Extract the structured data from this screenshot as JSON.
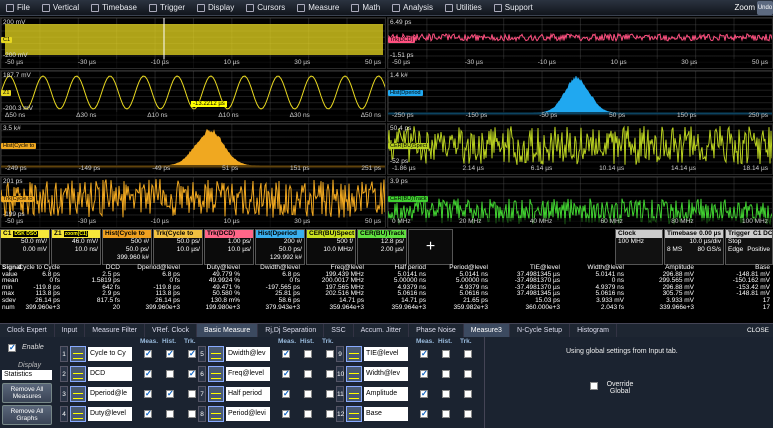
{
  "menu": [
    {
      "label": "File",
      "icon": "folder-icon"
    },
    {
      "label": "Vertical",
      "icon": "vertical-icon"
    },
    {
      "label": "Timebase",
      "icon": "timebase-icon"
    },
    {
      "label": "Trigger",
      "icon": "trigger-icon"
    },
    {
      "label": "Display",
      "icon": "display-icon"
    },
    {
      "label": "Cursors",
      "icon": "cursors-icon"
    },
    {
      "label": "Measure",
      "icon": "measure-icon"
    },
    {
      "label": "Math",
      "icon": "math-icon"
    },
    {
      "label": "Analysis",
      "icon": "analysis-icon"
    },
    {
      "label": "Utilities",
      "icon": "utilities-icon"
    },
    {
      "label": "Support",
      "icon": "support-icon"
    }
  ],
  "zoom": {
    "label": "Zoom",
    "btn": "Undo"
  },
  "panels": {
    "p1": {
      "ytop": "200 mV",
      "ybot": "-200 mV",
      "tag": "C1",
      "ticks": [
        "-50 µs",
        "-30 µs",
        "-10 µs",
        "10 µs",
        "30 µs",
        "50 µs"
      ]
    },
    "p2": {
      "ytop": "187.7 mV",
      "ybot": "-200.3 mV",
      "tag": "Z1",
      "cursor": "-13.2212 µs",
      "ticks": [
        "Δ50 ns",
        "Δ30 ns",
        "Δ10 ns",
        "Δ10 ns",
        "Δ30 ns",
        "Δ50 ns"
      ]
    },
    "p3": {
      "ytop": "3.5 k#",
      "tag": "Hist(Cycle to",
      "ticks": [
        "-249 ps",
        "-149 ps",
        "-49 ps",
        "51 ps",
        "151 ps",
        "251 ps"
      ]
    },
    "p4": {
      "ytop": "201 ps",
      "ybot": "-199 ps",
      "tag": "Trk(Cycle to",
      "ticks": [
        "-50 µs",
        "-30 µs",
        "-10 µs",
        "10 µs",
        "30 µs",
        "50 µs"
      ]
    },
    "p5": {
      "ytop": "6.49 ps",
      "ybot": "-1.51 ps",
      "tag": "Trk(DCD)",
      "ticks": [
        "-50 µs",
        "-30 µs",
        "-10 µs",
        "10 µs",
        "30 µs",
        "50 µs"
      ]
    },
    "p6": {
      "ytop": "1.4 k#",
      "tag": "Hist(Dperiod",
      "ticks": [
        "-250 ps",
        "-150 ps",
        "-50 ps",
        "50 ps",
        "150 ps",
        "250 ps"
      ]
    },
    "p7": {
      "ytop": "50.4 ps",
      "ybot": "-52 ps",
      "tag": "CER(BU)Spect",
      "ticks": [
        "-1.86 µs",
        "2.14 µs",
        "6.14 µs",
        "10.14 µs",
        "14.14 µs",
        "18.14 µs"
      ]
    },
    "p8": {
      "ytop": "3.9 ps",
      "tag": "CER(BU)Track",
      "ticks": [
        "0 MHz",
        "20 MHz",
        "40 MHz",
        "60 MHz",
        "80 MHz",
        "100 MHz"
      ]
    }
  },
  "descriptors": [
    {
      "name": "C1",
      "sub": "DSK DSO",
      "color": "#f5e63a",
      "v1": "50.0 mV/",
      "v2": "0.00 mV"
    },
    {
      "name": "Z1",
      "sub": "zoom(C1)",
      "color": "#f5e63a",
      "v1": "46.0 mV/",
      "v2": "10.0 ns/"
    },
    {
      "name": "Hist(Cycle to",
      "sub": "",
      "color": "#f0a020",
      "v1": "500 #/",
      "v2": "50.0 ps/",
      "v3": "399.960 k#"
    },
    {
      "name": "Trk(Cycle to",
      "sub": "",
      "color": "#f0c040",
      "v1": "50.0 ps/",
      "v2": "10.0 µs/"
    },
    {
      "name": "Trk(DCD)",
      "sub": "",
      "color": "#ff6688",
      "v1": "1.00 ps/",
      "v2": "10.0 µs/"
    },
    {
      "name": "Hist(Dperiod",
      "sub": "",
      "color": "#3ab0f0",
      "v1": "200 #/",
      "v2": "50.0 ps/",
      "v3": "129.992 k#"
    },
    {
      "name": "CER(BU)Spect",
      "sub": "",
      "color": "#c8e020",
      "v1": "500 f/",
      "v2": "10.0 MHz/"
    },
    {
      "name": "CER(BU)Track",
      "sub": "",
      "color": "#60e040",
      "v1": "12.8 ps/",
      "v2": "2.00 µs/"
    }
  ],
  "status": {
    "clock": "Clock",
    "clock_v": "100 MHz",
    "timebase": "Timebase",
    "tb_v": "0.00 µs",
    "tb_div": "10.0 µs/div",
    "tb_s": "8 MS",
    "tb_rate": "80 GS/s",
    "trigger": "Trigger",
    "trig_ch": "C1 DC",
    "trig_mode": "Stop",
    "trig_type": "Edge",
    "trig_slope": "Positive"
  },
  "measurements": {
    "labels": [
      "Signal",
      "value",
      "mean",
      "min",
      "max",
      "sdev",
      "num"
    ],
    "cols": [
      {
        "h": "Cycle to Cycle",
        "v": [
          "6.8 ps",
          "0 fs",
          "-119.8 ps",
          "113.8 ps",
          "26.14 ps",
          "399.960e+3"
        ]
      },
      {
        "h": "DCD",
        "v": [
          "2.5 ps",
          "1.5819 ps",
          "642 fs",
          "2.9 ps",
          "817.5 fs",
          "20"
        ]
      },
      {
        "h": "Dperiod@level",
        "v": [
          "6.8 ps",
          "0 fs",
          "-119.8 ps",
          "113.8 ps",
          "26.14 ps",
          "399.960e+3"
        ]
      },
      {
        "h": "Duty@level",
        "v": [
          "49.779 %",
          "49.9924 %",
          "49.471 %",
          "50.580 %",
          "130.8 m%",
          "199.980e+3"
        ]
      },
      {
        "h": "Dwidth@level",
        "v": [
          "6.8 ps",
          "0 fs",
          "-197.565 ps",
          "25.81 ps",
          "58.6 ps",
          "379.943e+3"
        ]
      },
      {
        "h": "Freq@level",
        "v": [
          "199.439 MHz",
          "200.0017 MHz",
          "197.565 MHz",
          "202.516 MHz",
          "14.71 ps",
          "359.964e+3"
        ]
      },
      {
        "h": "Half period",
        "v": [
          "5.0141 ns",
          "5.00000 ns",
          "4.9379 ns",
          "5.0616 ns",
          "14.71 ps",
          "359.964e+3"
        ]
      },
      {
        "h": "Period@level",
        "v": [
          "5.0141 ns",
          "5.00000 ns",
          "4.9379 ns",
          "5.0616 ns",
          "21.65 ps",
          "359.982e+3"
        ]
      },
      {
        "h": "TIE@level",
        "v": [
          "37.4981345 µs",
          "-37.4981370 µs",
          "-37.4981370 µs",
          "37.4981345 µs",
          "15.03 ps",
          "360.000e+3"
        ]
      },
      {
        "h": "Width@level",
        "v": [
          "5.0141 ns",
          "0 ns",
          "4.9379 ns",
          "5.0616 ns",
          "3.933 mV",
          "2.043 fs"
        ]
      },
      {
        "h": "Amplitude",
        "v": [
          "296.88 mV",
          "299.565 mV",
          "296.88 mV",
          "305.75 mV",
          "3.933 mV",
          "339.966e+3"
        ]
      },
      {
        "h": "Base",
        "v": [
          "-148.81 mV",
          "-150.162 mV",
          "-153.42 mV",
          "-148.81 mV",
          "17",
          "17"
        ]
      }
    ]
  },
  "tabs": [
    "Clock Expert",
    "Input",
    "Measure Filter",
    "VRef. Clock",
    "Basic Measure",
    "Rj,Dj Separation",
    "SSC",
    "Accum. Jitter",
    "Phase Noise",
    "Measure3",
    "N-Cycle Setup",
    "Histogram"
  ],
  "close": "CLOSE",
  "dialog": {
    "enable": "Enable",
    "display": "Display",
    "display_val": "Statistics",
    "remove_measures": "Remove All Measures",
    "remove_graphs": "Remove All Graphs",
    "hdr": [
      "Meas.",
      "Hist.",
      "Trk."
    ],
    "slots": [
      {
        "n": "1",
        "name": "Cycle to Cy",
        "m": true,
        "h": true,
        "t": true
      },
      {
        "n": "2",
        "name": "DCD",
        "m": true,
        "h": false,
        "t": true
      },
      {
        "n": "3",
        "name": "Dperiod@le",
        "m": true,
        "h": true,
        "t": false
      },
      {
        "n": "4",
        "name": "Duty@level",
        "m": true,
        "h": false,
        "t": false
      },
      {
        "n": "5",
        "name": "Dwidth@lev",
        "m": true,
        "h": false,
        "t": false
      },
      {
        "n": "6",
        "name": "Freq@level",
        "m": true,
        "h": false,
        "t": false
      },
      {
        "n": "7",
        "name": "Half period",
        "m": true,
        "h": false,
        "t": false
      },
      {
        "n": "8",
        "name": "Period@levi",
        "m": true,
        "h": false,
        "t": false
      },
      {
        "n": "9",
        "name": "TIE@level",
        "m": true,
        "h": false,
        "t": false
      },
      {
        "n": "10",
        "name": "Width@lev",
        "m": true,
        "h": false,
        "t": false
      },
      {
        "n": "11",
        "name": "Amplitude",
        "m": true,
        "h": false,
        "t": false
      },
      {
        "n": "12",
        "name": "Base",
        "m": true,
        "h": false,
        "t": false
      }
    ],
    "global_msg": "Using global settings from Input tab.",
    "override": "Override Global"
  },
  "colors": {
    "yellow": "#e8d820",
    "orange": "#f0a820",
    "pink": "#ff5080",
    "blue": "#20a8f0",
    "lime": "#b8d020",
    "green": "#40d030"
  }
}
